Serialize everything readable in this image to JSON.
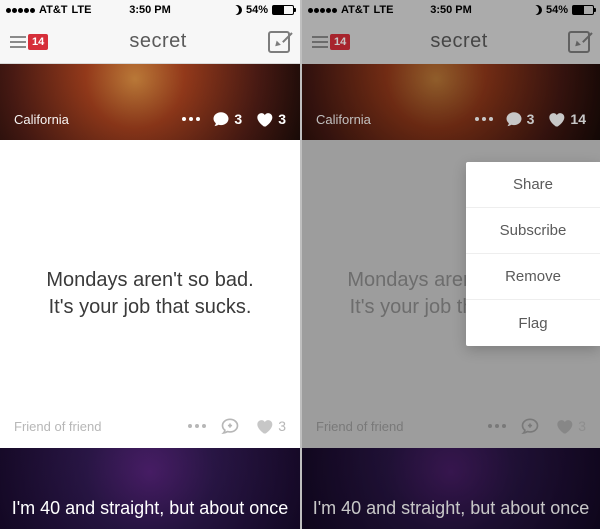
{
  "status": {
    "carrier": "AT&T",
    "network": "LTE",
    "time": "3:50 PM",
    "battery_pct": "54%"
  },
  "nav": {
    "badge": "14",
    "title": "secret"
  },
  "post1_left": {
    "location": "California",
    "comments": "3",
    "likes": "3"
  },
  "post1_right": {
    "location": "California",
    "comments": "3",
    "likes": "14"
  },
  "post2": {
    "text": "Mondays aren't so bad. It's your job that sucks.",
    "source": "Friend of friend",
    "likes": "3"
  },
  "post3": {
    "text": "I'm 40 and straight, but about once"
  },
  "popover": {
    "items": [
      "Share",
      "Subscribe",
      "Remove",
      "Flag"
    ]
  }
}
